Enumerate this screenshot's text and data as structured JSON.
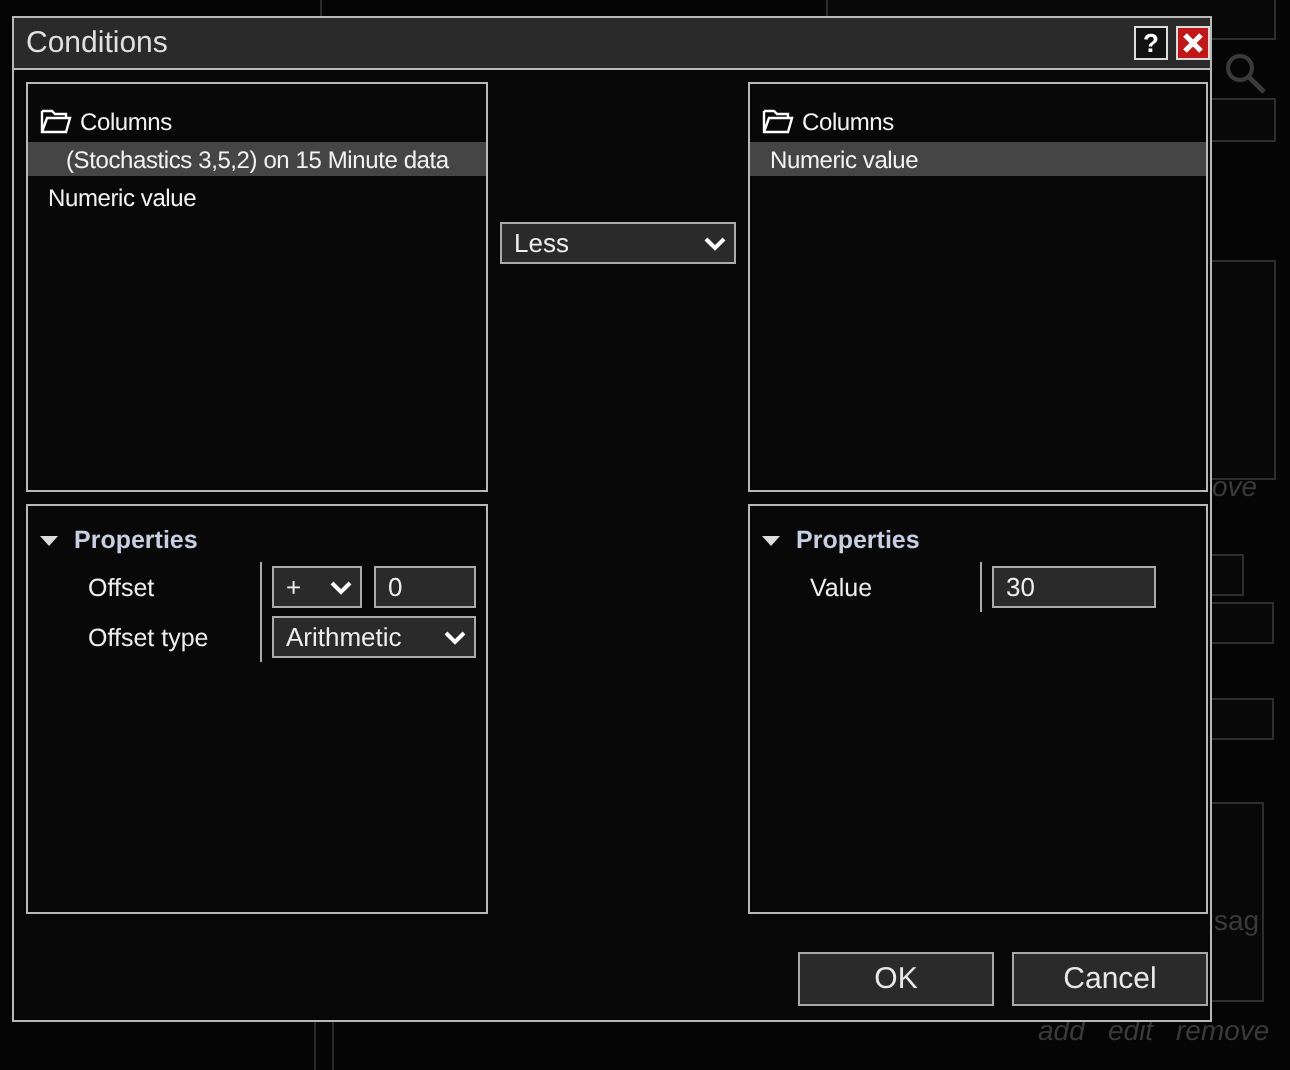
{
  "background": {
    "cut_label": "ove",
    "cut_text": "sag",
    "links": [
      "add",
      "edit",
      "remove"
    ]
  },
  "window": {
    "title": "Conditions",
    "help": "?"
  },
  "left": {
    "tree": [
      {
        "label": "Columns",
        "kind": "folder",
        "selected": false,
        "children": [
          {
            "label": "(Stochastics 3,5,2) on 15 Minute data",
            "kind": "item",
            "selected": true
          }
        ]
      },
      {
        "label": "Numeric value",
        "kind": "item",
        "selected": false
      }
    ],
    "properties": {
      "title": "Properties",
      "expanded": true,
      "rows": [
        {
          "label": "Offset",
          "controls": [
            {
              "kind": "select",
              "value": "+"
            },
            {
              "kind": "input",
              "value": "0"
            }
          ]
        },
        {
          "label": "Offset type",
          "controls": [
            {
              "kind": "select",
              "value": "Arithmetic"
            }
          ]
        }
      ]
    }
  },
  "operator": {
    "value": "Less"
  },
  "right": {
    "tree": [
      {
        "label": "Columns",
        "kind": "folder",
        "selected": false
      },
      {
        "label": "Numeric value",
        "kind": "item",
        "selected": true
      }
    ],
    "properties": {
      "title": "Properties",
      "expanded": true,
      "rows": [
        {
          "label": "Value",
          "controls": [
            {
              "kind": "input",
              "value": "30"
            }
          ]
        }
      ]
    }
  },
  "buttons": [
    "OK",
    "Cancel"
  ]
}
